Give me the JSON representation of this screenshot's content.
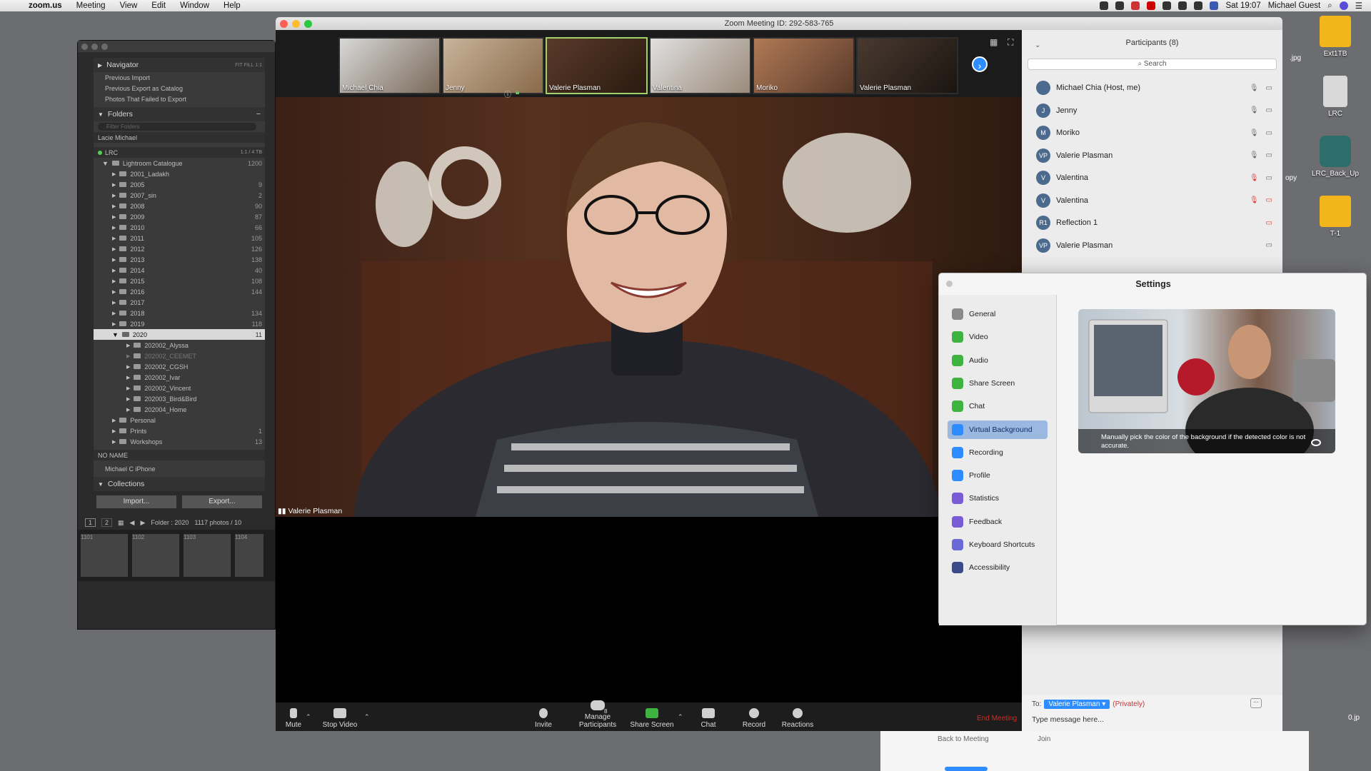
{
  "menubar": {
    "apple": "",
    "app": "zoom.us",
    "items": [
      "Meeting",
      "View",
      "Edit",
      "Window",
      "Help"
    ],
    "clock": "Sat 19:07",
    "user": "Michael Guest"
  },
  "desktop": {
    "icons": [
      "Ext1TB",
      "LRC",
      "LRC_Back_Up",
      "T-1"
    ],
    "partial": [
      ".jpg",
      "opy",
      "0.jp"
    ]
  },
  "lightroom": {
    "navigator": "Navigator",
    "nav_opts": "FIT  FILL  1:1",
    "catalog": [
      "Previous Import",
      "Previous Export as Catalog",
      "Photos That Failed to Export"
    ],
    "folders_title": "Folders",
    "filter_placeholder": "Filter Folders",
    "volume1": "Lacie Michael",
    "volume2": "LRC",
    "volume2_size": "1.1 / 4 TB",
    "root": {
      "name": "Lightroom Catalogue",
      "count": "1200"
    },
    "folders": [
      {
        "name": "2001_Ladakh",
        "count": ""
      },
      {
        "name": "2005",
        "count": "9"
      },
      {
        "name": "2007_sin",
        "count": "2"
      },
      {
        "name": "2008",
        "count": "90"
      },
      {
        "name": "2009",
        "count": "87"
      },
      {
        "name": "2010",
        "count": "66"
      },
      {
        "name": "2011",
        "count": "105"
      },
      {
        "name": "2012",
        "count": "126"
      },
      {
        "name": "2013",
        "count": "138"
      },
      {
        "name": "2014",
        "count": "40"
      },
      {
        "name": "2015",
        "count": "108"
      },
      {
        "name": "2016",
        "count": "144"
      },
      {
        "name": "2017",
        "count": ""
      },
      {
        "name": "2018",
        "count": "134"
      },
      {
        "name": "2019",
        "count": "118"
      },
      {
        "name": "2020",
        "count": "11"
      }
    ],
    "subfolders": [
      "202002_Alyssa",
      "202002_CEEMET",
      "202002_CGSH",
      "202002_Ivar",
      "202002_Vincent",
      "202003_Bird&Bird",
      "202004_Home"
    ],
    "others": [
      "Personal",
      "Prints",
      "Workshops"
    ],
    "others_counts": [
      "",
      "1",
      "13"
    ],
    "no_name": "NO NAME",
    "iphone": "Michael C iPhone",
    "collections": "Collections",
    "import": "Import...",
    "export": "Export...",
    "page1": "1",
    "page2": "2",
    "folder_info": "Folder : 2020",
    "count_info": "1117 photos / 10",
    "film_nums": [
      "1101",
      "1102",
      "1103",
      "1104"
    ]
  },
  "zoom": {
    "title": "Zoom Meeting ID: 292-583-765",
    "gallery": [
      "Michael Chia",
      "Jenny",
      "Valerie Plasman",
      "Valentina",
      "Moriko",
      "Valerie Plasman"
    ],
    "speaker": "Valerie Plasman",
    "toolbar": {
      "mute": "Mute",
      "stop_video": "Stop Video",
      "invite": "Invite",
      "manage": "Manage Participants",
      "manage_count": "8",
      "share": "Share Screen",
      "chat": "Chat",
      "record": "Record",
      "reactions": "Reactions",
      "end": "End Meeting"
    }
  },
  "participants": {
    "title": "Participants (8)",
    "search": "Search",
    "list": [
      {
        "initials": "",
        "name": "Michael Chia (Host, me)"
      },
      {
        "initials": "J",
        "name": "Jenny"
      },
      {
        "initials": "M",
        "name": "Moriko"
      },
      {
        "initials": "VP",
        "name": "Valerie Plasman"
      },
      {
        "initials": "V",
        "name": "Valentina"
      },
      {
        "initials": "V",
        "name": "Valentina"
      },
      {
        "initials": "R1",
        "name": "Reflection 1"
      },
      {
        "initials": "VP",
        "name": "Valerie Plasman"
      }
    ]
  },
  "settings": {
    "title": "Settings",
    "items": [
      "General",
      "Video",
      "Audio",
      "Share Screen",
      "Chat",
      "Virtual Background",
      "Recording",
      "Profile",
      "Statistics",
      "Feedback",
      "Keyboard Shortcuts",
      "Accessibility"
    ],
    "active": "Virtual Background",
    "tooltip": "Manually pick the color of the background if the detected color is not accurate."
  },
  "chat": {
    "to": "To:",
    "recipient": "Valerie Plasman",
    "privately": "(Privately)",
    "placeholder": "Type message here...",
    "back": "Back to Meeting",
    "join": "Join"
  },
  "colors": {
    "zoom_blue": "#2d8cff",
    "end_red": "#e0241d",
    "share_green": "#3fb33f"
  }
}
